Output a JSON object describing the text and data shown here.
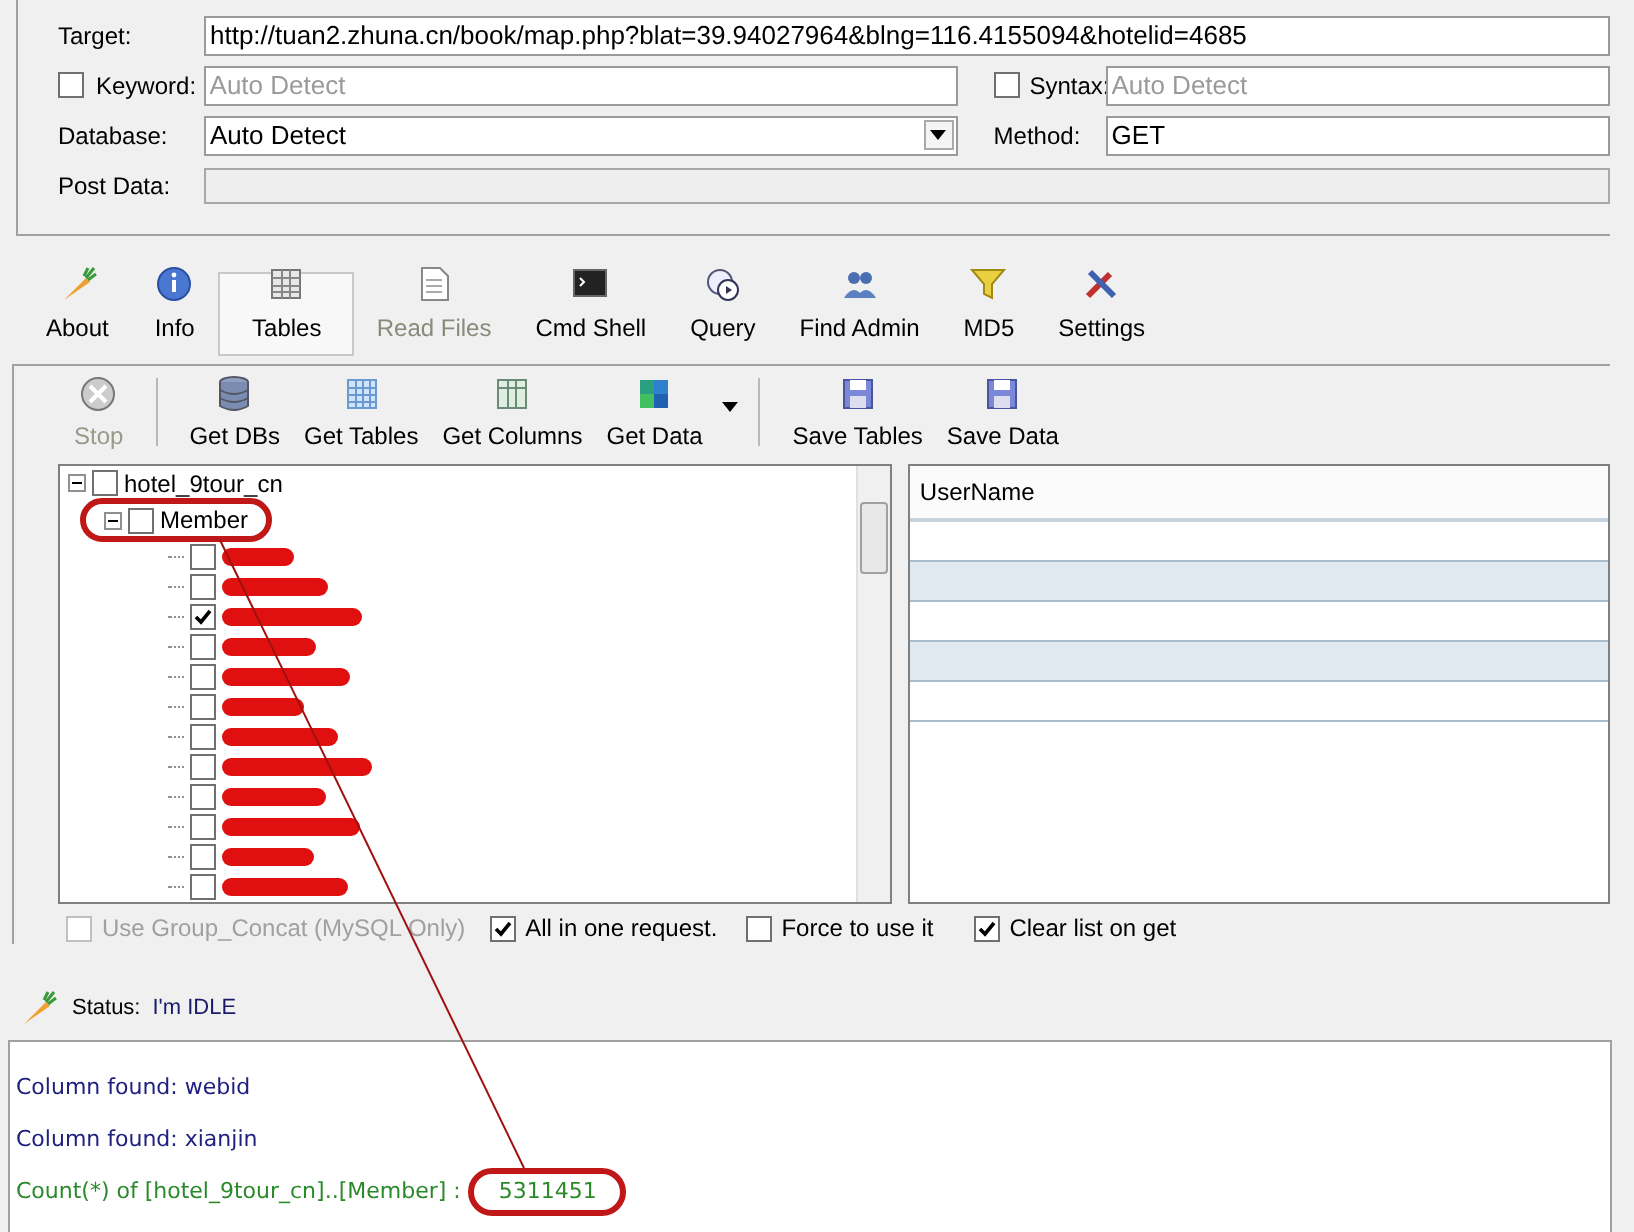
{
  "form": {
    "target": {
      "label": "Target:",
      "value": "http://tuan2.zhuna.cn/book/map.php?blat=39.94027964&blng=116.4155094&hotelid=4685"
    },
    "keyword": {
      "label": "Keyword:",
      "checked": false,
      "placeholder": "Auto Detect"
    },
    "syntax": {
      "label": "Syntax:",
      "checked": false,
      "placeholder": "Auto Detect"
    },
    "database": {
      "label": "Database:",
      "value": "Auto Detect"
    },
    "method": {
      "label": "Method:",
      "value": "GET"
    },
    "post_data": {
      "label": "Post Data:"
    }
  },
  "tabs": [
    {
      "label": "About",
      "selected": false,
      "disabled": false
    },
    {
      "label": "Info",
      "selected": false,
      "disabled": false
    },
    {
      "label": "Tables",
      "selected": true,
      "disabled": false
    },
    {
      "label": "Read Files",
      "selected": false,
      "disabled": true
    },
    {
      "label": "Cmd Shell",
      "selected": false,
      "disabled": false
    },
    {
      "label": "Query",
      "selected": false,
      "disabled": false
    },
    {
      "label": "Find Admin",
      "selected": false,
      "disabled": false
    },
    {
      "label": "MD5",
      "selected": false,
      "disabled": false
    },
    {
      "label": "Settings",
      "selected": false,
      "disabled": false
    }
  ],
  "actions": [
    {
      "label": "Stop",
      "disabled": true
    },
    {
      "label": "Get DBs",
      "disabled": false
    },
    {
      "label": "Get Tables",
      "disabled": false
    },
    {
      "label": "Get Columns",
      "disabled": false
    },
    {
      "label": "Get Data",
      "disabled": false,
      "dropdown": true
    },
    {
      "label": "Save Tables",
      "disabled": false
    },
    {
      "label": "Save Data",
      "disabled": false
    }
  ],
  "tree": {
    "label": "hotel_9tour_cn",
    "checked": false,
    "expanded": true,
    "children": [
      {
        "label": "Member",
        "checked": false,
        "expanded": true,
        "children": [
          {
            "checked": false
          },
          {
            "checked": false
          },
          {
            "checked": true
          },
          {
            "checked": false
          },
          {
            "checked": false
          },
          {
            "checked": false
          },
          {
            "checked": false
          },
          {
            "checked": false
          },
          {
            "checked": false
          },
          {
            "checked": false
          },
          {
            "checked": false
          },
          {
            "checked": false
          }
        ]
      }
    ]
  },
  "grid": {
    "columns": [
      "UserName"
    ]
  },
  "options": [
    {
      "label": "Use Group_Concat (MySQL Only)",
      "checked": false,
      "disabled": true
    },
    {
      "label": "All in one request.",
      "checked": true,
      "disabled": false
    },
    {
      "label": "Force to use it",
      "checked": false,
      "disabled": false
    },
    {
      "label": "Clear list on get",
      "checked": true,
      "disabled": false
    }
  ],
  "status": {
    "label": "Status:",
    "value": "I'm IDLE"
  },
  "log": [
    {
      "text": "Column found: webid",
      "kind": "info"
    },
    {
      "text": "Column found: xianjin",
      "kind": "info"
    },
    {
      "text": "Count(*) of [hotel_9tour_cn]..[Member] :",
      "value": "5311451",
      "kind": "result"
    }
  ]
}
